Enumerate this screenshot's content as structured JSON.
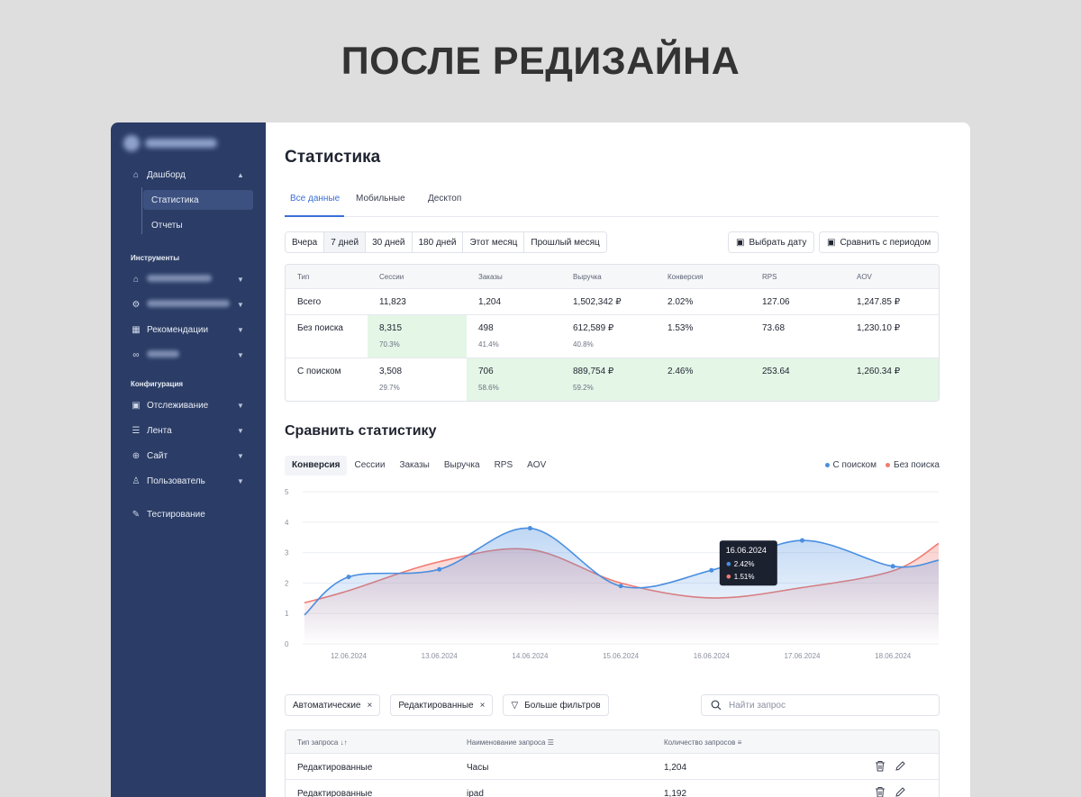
{
  "headline": "ПОСЛЕ РЕДИЗАЙНА",
  "sidebar": {
    "dashboard": "Дашборд",
    "statistics": "Статистика",
    "reports": "Отчеты",
    "tools_heading": "Инструменты",
    "recommendations": "Рекомендации",
    "config_heading": "Конфигурация",
    "tracking": "Отслеживание",
    "feed": "Лента",
    "site": "Сайт",
    "user": "Пользователь",
    "testing": "Тестирование"
  },
  "page_title": "Статистика",
  "tabs": [
    "Все данные",
    "Мобильные",
    "Десктоп"
  ],
  "periods": [
    "Вчера",
    "7 дней",
    "30 дней",
    "180 дней",
    "Этот месяц",
    "Прошлый месяц"
  ],
  "buttons": {
    "pick_date": "Выбрать дату",
    "compare_period": "Сравнить с периодом"
  },
  "stats_table": {
    "headers": [
      "Тип",
      "Сессии",
      "Заказы",
      "Выручка",
      "Конверсия",
      "RPS",
      "AOV"
    ],
    "rows": [
      {
        "type": "Всего",
        "sessions": "11,823",
        "orders": "1,204",
        "revenue": "1,502,342 ₽",
        "conversion": "2.02%",
        "rps": "127.06",
        "aov": "1,247.85 ₽"
      },
      {
        "type": "Без поиска",
        "sessions": "8,315",
        "sessions_pct": "70.3%",
        "orders": "498",
        "orders_pct": "41.4%",
        "revenue": "612,589 ₽",
        "revenue_pct": "40.8%",
        "conversion": "1.53%",
        "rps": "73.68",
        "aov": "1,230.10 ₽"
      },
      {
        "type": "С поиском",
        "sessions": "3,508",
        "sessions_pct": "29.7%",
        "orders": "706",
        "orders_pct": "58.6%",
        "revenue": "889,754 ₽",
        "revenue_pct": "59.2%",
        "conversion": "2.46%",
        "rps": "253.64",
        "aov": "1,260.34 ₽"
      }
    ]
  },
  "compare_title": "Сравнить статистику",
  "metric_tabs": [
    "Конверсия",
    "Сессии",
    "Заказы",
    "Выручка",
    "RPS",
    "AOV"
  ],
  "colors": {
    "with_search": "#4a8ee0",
    "without_search": "#f07b72",
    "accent": "#3a6fd8",
    "sidebar": "#2b3d66",
    "highlight": "#e4f6e6"
  },
  "chart_data": {
    "type": "line",
    "x": [
      "12.06.2024",
      "13.06.2024",
      "14.06.2024",
      "15.06.2024",
      "16.06.2024",
      "17.06.2024",
      "18.06.2024"
    ],
    "ylim": [
      0,
      5
    ],
    "yticks": [
      "0",
      "1",
      "2",
      "3",
      "4",
      "5"
    ],
    "legend_position": "top-right",
    "grid": true,
    "series": [
      {
        "name": "С поиском",
        "color": "#4a8ee0",
        "values": [
          2.2,
          2.45,
          3.8,
          1.9,
          2.42,
          3.4,
          2.55
        ],
        "start": 0.95,
        "end": 2.75
      },
      {
        "name": "Без поиска",
        "color": "#f07b72",
        "values": [
          1.75,
          2.7,
          3.1,
          2.0,
          1.51,
          1.85,
          2.4
        ],
        "start": 1.35,
        "end": 3.3
      }
    ],
    "tooltip": {
      "date": "16.06.2024",
      "with_search": "2.42%",
      "without_search": "1.51%"
    }
  },
  "filters": {
    "chips": [
      "Автоматические",
      "Редактированные"
    ],
    "more": "Больше фильтров",
    "search_placeholder": "Найти запрос",
    "close_glyph": "×"
  },
  "query_table": {
    "headers": [
      "Тип запроса",
      "Наименование запроса",
      "Количество запросов"
    ],
    "rows": [
      {
        "type": "Редактированные",
        "name": "Часы",
        "count": "1,204"
      },
      {
        "type": "Редактированные",
        "name": "ipad",
        "count": "1,192"
      }
    ]
  }
}
